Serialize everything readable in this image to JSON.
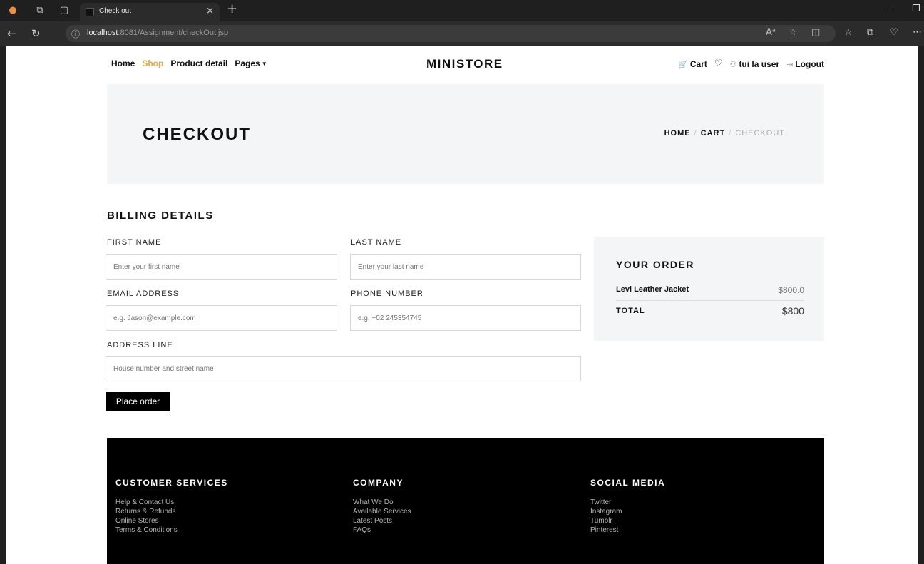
{
  "browser": {
    "tab_title": "Check out",
    "tab_close": "×",
    "new_tab": "+",
    "url_host": "localhost",
    "url_path": ":8081/Assignment/checkOut.jsp",
    "icons": [
      "profile-icon",
      "workspaces-icon",
      "tab-actions-icon",
      "back-icon",
      "refresh-icon",
      "info-icon",
      "read-aloud-icon",
      "favorite-icon",
      "split-screen-icon",
      "favorites-icon",
      "collections-icon",
      "copilot-icon",
      "more-icon"
    ]
  },
  "nav": {
    "menu": [
      "Home",
      "Shop",
      "Product detail",
      "Pages"
    ],
    "active_color": "#e2a744",
    "brand": "MINISTORE",
    "cart": "Cart",
    "user": "tui la user",
    "logout": "Logout"
  },
  "hero": {
    "title": "CHECKOUT",
    "breadcrumb": [
      "HOME",
      "CART",
      "CHECKOUT"
    ],
    "separator": "/"
  },
  "billing": {
    "title": "BILLING DETAILS",
    "first_name_label": "FIRST NAME",
    "first_name_placeholder": "Enter your first name",
    "last_name_label": "LAST NAME",
    "last_name_placeholder": "Enter your last name",
    "email_label": "EMAIL ADDRESS",
    "email_placeholder": "e.g. Jason@example.com",
    "phone_label": "PHONE NUMBER",
    "phone_placeholder": "e.g. +02 245354745",
    "address_label": "ADDRESS LINE",
    "address_placeholder": "House number and street name",
    "place_order": "Place order"
  },
  "order": {
    "title": "YOUR ORDER",
    "item_name": "Levi Leather Jacket",
    "item_price": "$800.0",
    "total_label": "TOTAL",
    "total": "$800"
  },
  "footer": {
    "col1": {
      "title": "CUSTOMER SERVICES",
      "links": [
        "Help & Contact Us",
        "Returns & Refunds",
        "Online Stores",
        "Terms & Conditions"
      ]
    },
    "col2": {
      "title": "COMPANY",
      "links": [
        "What We Do",
        "Available Services",
        "Latest Posts",
        "FAQs"
      ]
    },
    "col3": {
      "title": "SOCIAL MEDIA",
      "links": [
        "Twitter",
        "Instagram",
        "Tumblr",
        "Pinterest"
      ]
    }
  }
}
